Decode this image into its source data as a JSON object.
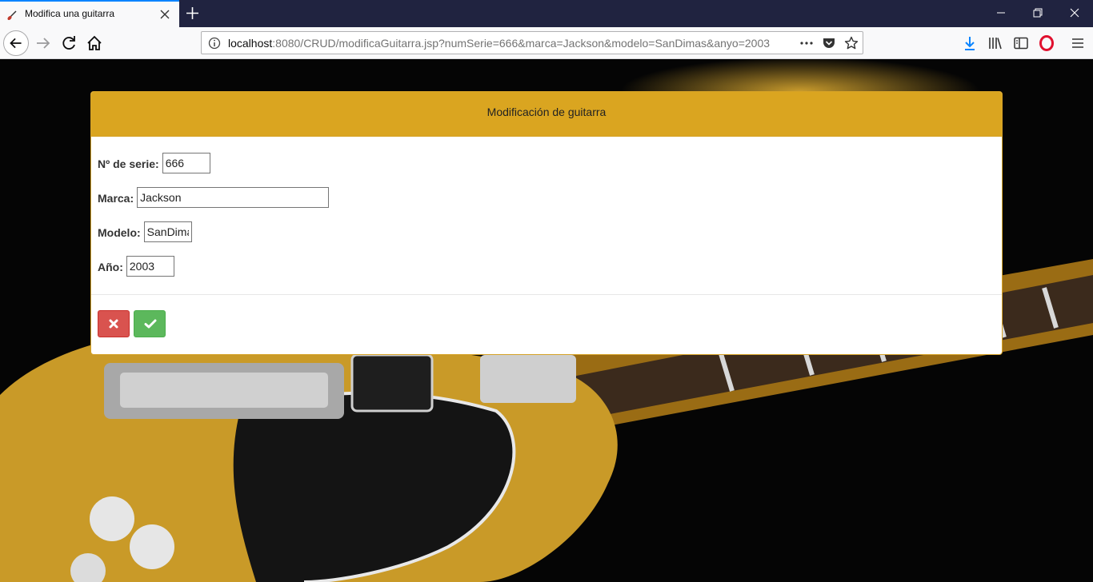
{
  "browser": {
    "tab_title": "Modifica una guitarra",
    "url_host": "localhost",
    "url_rest": ":8080/CRUD/modificaGuitarra.jsp?numSerie=666&marca=Jackson&modelo=SanDimas&anyo=2003"
  },
  "icons": {
    "tab_favicon": "guitar-icon",
    "tab_close": "close-icon",
    "new_tab": "plus-icon",
    "minimize": "minimize-icon",
    "restore": "restore-icon",
    "close_window": "close-icon",
    "back": "back-arrow-icon",
    "forward": "forward-arrow-icon",
    "reload": "reload-icon",
    "home": "home-icon",
    "site_info": "info-icon",
    "page_actions": "more-horizontal-icon",
    "pocket": "pocket-icon",
    "bookmark": "star-icon",
    "downloads": "download-icon",
    "library": "library-icon",
    "sidebar": "sidebar-icon",
    "opera": "opera-icon",
    "menu": "hamburger-menu-icon",
    "cancel": "times-icon",
    "confirm": "check-icon"
  },
  "panel": {
    "heading": "Modificación de guitarra",
    "fields": {
      "serial": {
        "label": "Nº de serie:",
        "value": "666"
      },
      "brand": {
        "label": "Marca:",
        "value": "Jackson"
      },
      "model": {
        "label": "Modelo:",
        "value": "SanDimas"
      },
      "year": {
        "label": "Año:",
        "value": "2003"
      }
    }
  },
  "colors": {
    "panel_heading": "#daa520",
    "cancel_button": "#d9534f",
    "confirm_button": "#5cb85c",
    "tab_accent": "#0a84ff"
  }
}
